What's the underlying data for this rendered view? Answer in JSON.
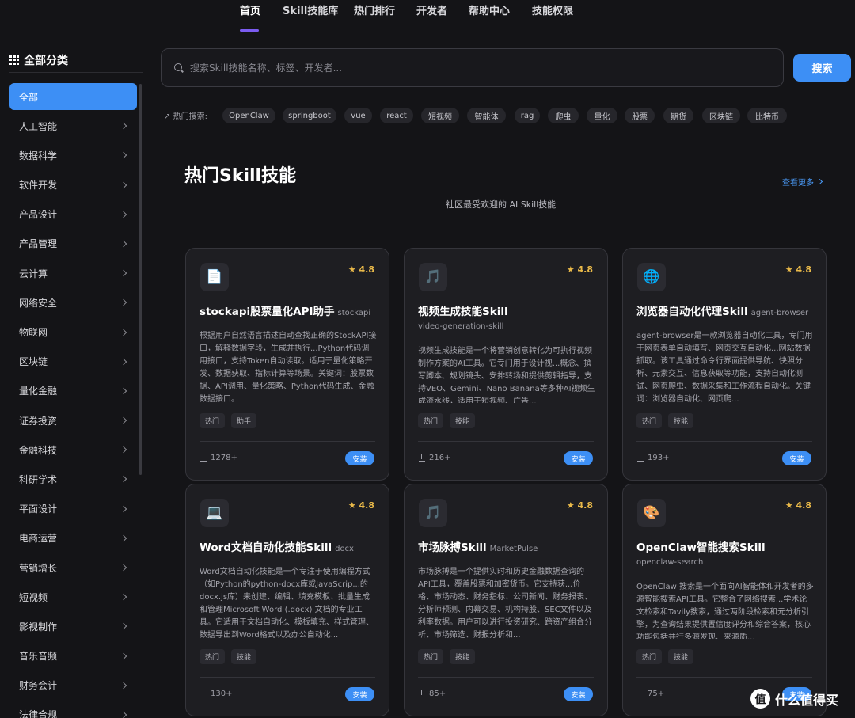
{
  "nav": {
    "items": [
      "首页",
      "Skill技能库",
      "热门排行",
      "开发者",
      "帮助中心",
      "技能权限"
    ],
    "active_index": 0
  },
  "sidebar": {
    "heading": "全部分类",
    "items": [
      {
        "label": "全部",
        "active": true
      },
      {
        "label": "人工智能"
      },
      {
        "label": "数据科学"
      },
      {
        "label": "软件开发"
      },
      {
        "label": "产品设计"
      },
      {
        "label": "产品管理"
      },
      {
        "label": "云计算"
      },
      {
        "label": "网络安全"
      },
      {
        "label": "物联网"
      },
      {
        "label": "区块链"
      },
      {
        "label": "量化金融"
      },
      {
        "label": "证券投资"
      },
      {
        "label": "金融科技"
      },
      {
        "label": "科研学术"
      },
      {
        "label": "平面设计"
      },
      {
        "label": "电商运营"
      },
      {
        "label": "营销增长"
      },
      {
        "label": "短视频"
      },
      {
        "label": "影视制作"
      },
      {
        "label": "音乐音频"
      },
      {
        "label": "财务会计"
      },
      {
        "label": "法律合规"
      }
    ]
  },
  "search": {
    "placeholder": "搜索Skill技能名称、标签、开发者...",
    "value": "",
    "button_label": "搜索"
  },
  "hot_search": {
    "label": "热门搜索:",
    "tags": [
      "OpenClaw",
      "springboot",
      "vue",
      "react",
      "短视频",
      "智能体",
      "rag",
      "爬虫",
      "量化",
      "股票",
      "期货",
      "区块链",
      "比特币"
    ]
  },
  "section": {
    "title": "热门Skill技能",
    "subtitle": "社区最受欢迎的 AI Skill技能",
    "see_more": "查看更多"
  },
  "cards": [
    {
      "icon": "document-icon",
      "glyph": "📄",
      "rating": "★ 4.8",
      "title": "stockapi股票量化API助手",
      "slug": "stockapi",
      "slug_inline": true,
      "desc": "根据用户自然语言描述自动查找正确的StockAPI接口，解释数据字段，生成并执行...Python代码调用接口，支持Token自动读取。适用于量化策略开发、数据获取、指标计算等场景。关键词：股票数据、API调用、量化策略、Python代码生成、金融数据接口。",
      "tags": [
        "热门",
        "助手"
      ],
      "downloads": "1278+",
      "install": "安装"
    },
    {
      "icon": "music-note-icon",
      "glyph": "🎵",
      "rating": "★ 4.8",
      "title": "视频生成技能Skill",
      "slug": "video-generation-skill",
      "slug_inline": false,
      "desc": "视频生成技能是一个将营销创意转化为可执行视频制作方案的AI工具。它专门用于设计视...概念、撰写脚本、规划镜头、安排转场和提供剪辑指导，支持VEO、Gemini、Nano Banana等多种AI视频生成流水线，适用于短视频、广告...",
      "tags": [
        "热门",
        "技能"
      ],
      "downloads": "216+",
      "install": "安装"
    },
    {
      "icon": "globe-icon",
      "glyph": "🌐",
      "rating": "★ 4.8",
      "title": "浏览器自动化代理Skill",
      "slug": "agent-browser",
      "slug_inline": true,
      "desc": "agent-browser是一款浏览器自动化工具，专门用于网页表单自动填写、网页交互自动化...网站数据抓取。该工具通过命令行界面提供导航、快照分析、元素交互、信息获取等功能，支持自动化测试、网页爬虫、数据采集和工作流程自动化。关键词：浏览器自动化、网页爬...",
      "tags": [
        "热门",
        "技能"
      ],
      "downloads": "193+",
      "install": "安装"
    },
    {
      "icon": "laptop-icon",
      "glyph": "💻",
      "rating": "★ 4.8",
      "title": "Word文档自动化技能Skill",
      "slug": "docx",
      "slug_inline": true,
      "desc": "Word文档自动化技能是一个专注于使用编程方式（如Python的python-docx库或JavaScrip...的docx.js库）来创建、编辑、填充模板、批量生成和管理Microsoft Word (.docx) 文档的专业工具。它适用于文档自动化、模板填充、样式管理、数据导出到Word格式以及办公自动化...",
      "tags": [
        "热门",
        "技能"
      ],
      "downloads": "130+",
      "install": "安装"
    },
    {
      "icon": "music-note-icon",
      "glyph": "🎵",
      "rating": "★ 4.8",
      "title": "市场脉搏Skill",
      "slug": "MarketPulse",
      "slug_inline": true,
      "desc": "市场脉搏是一个提供实时和历史金融数据查询的API工具，覆盖股票和加密货币。它支持获...价格、市场动态、财务指标、公司新闻、财务报表、分析师预测、内幕交易、机构持股、SEC文件以及利率数据。用户可以进行投资研究、跨资产组合分析、市场筛选、财报分析和...",
      "tags": [
        "热门",
        "技能"
      ],
      "downloads": "85+",
      "install": "安装"
    },
    {
      "icon": "palette-icon",
      "glyph": "🎨",
      "rating": "★ 4.8",
      "title": "OpenClaw智能搜索Skill",
      "slug": "openclaw-search",
      "slug_inline": false,
      "desc": "OpenClaw 搜索是一个面向AI智能体和开发者的多源智能搜索API工具。它整合了网络搜索...学术论文检索和Tavily搜索，通过两阶段检索和元分析引擎，为查询结果提供置信度评分和综合答案，核心功能包括并行多源发现、来源质...",
      "tags": [
        "热门",
        "技能"
      ],
      "downloads": "75+",
      "install": "安装"
    }
  ],
  "watermark": {
    "glyph": "值",
    "text": "什么值得买"
  }
}
